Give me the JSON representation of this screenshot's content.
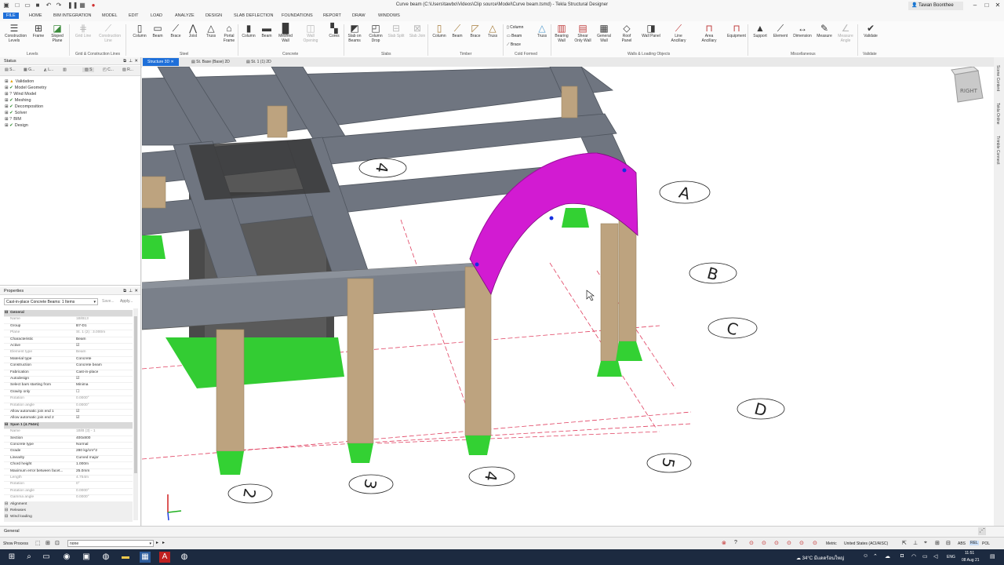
{
  "window": {
    "title": "Curve beam (C:\\Users\\tawbo\\Videos\\Clip source\\Model\\Curve beam.tsmd) - Tekla Structural Designer",
    "user": "Tawan Boonthee"
  },
  "menu_tabs": [
    "FILE",
    "HOME",
    "BIM INTEGRATION",
    "MODEL",
    "EDIT",
    "LOAD",
    "ANALYZE",
    "DESIGN",
    "SLAB DEFLECTION",
    "FOUNDATIONS",
    "REPORT",
    "DRAW",
    "WINDOWS"
  ],
  "ribbon": {
    "buttons": [
      {
        "label": "Construction Levels",
        "icon": "levels-icon"
      },
      {
        "label": "Frame",
        "icon": "frame-icon"
      },
      {
        "label": "Sloped Plane",
        "icon": "plane-icon"
      },
      {
        "label": "Grid Line",
        "icon": "grid-line-icon"
      },
      {
        "label": "Construction Line",
        "icon": "construction-line-icon"
      },
      {
        "label": "Column",
        "icon": "column-icon"
      },
      {
        "label": "Beam",
        "icon": "beam-icon"
      },
      {
        "label": "Brace",
        "icon": "brace-icon"
      },
      {
        "label": "Truss",
        "icon": "truss-icon"
      },
      {
        "label": "Portal Frame",
        "icon": "portal-icon"
      },
      {
        "label": "Column",
        "icon": "column-icon"
      },
      {
        "label": "Beam",
        "icon": "beam-icon"
      },
      {
        "label": "Meshed Wall",
        "icon": "wall-icon"
      },
      {
        "label": "Wall Opening",
        "icon": "opening-icon"
      },
      {
        "label": "Cores",
        "icon": "cores-icon"
      },
      {
        "label": "Slab on Beams",
        "icon": "slab-icon"
      },
      {
        "label": "Column Drop",
        "icon": "drop-icon"
      },
      {
        "label": "Slab Split",
        "icon": "split-icon"
      },
      {
        "label": "Slab Join",
        "icon": "join-icon"
      },
      {
        "label": "Column",
        "icon": "column-icon"
      },
      {
        "label": "Beam",
        "icon": "beam-icon"
      },
      {
        "label": "Brace",
        "icon": "brace-icon"
      },
      {
        "label": "Truss",
        "icon": "truss-icon"
      },
      {
        "label": "Truss",
        "icon": "truss-icon"
      },
      {
        "label": "Bearing Wall",
        "icon": "bearing-wall-icon"
      },
      {
        "label": "Shear Only Wall",
        "icon": "shear-wall-icon"
      },
      {
        "label": "General Wall",
        "icon": "general-wall-icon"
      },
      {
        "label": "Roof Panel",
        "icon": "roof-icon"
      },
      {
        "label": "Wall Panel",
        "icon": "wall-panel-icon"
      },
      {
        "label": "Line Ancillary",
        "icon": "line-ancillary-icon"
      },
      {
        "label": "Area Ancillary",
        "icon": "area-ancillary-icon"
      },
      {
        "label": "Equipment",
        "icon": "equipment-icon"
      },
      {
        "label": "Support",
        "icon": "support-icon"
      },
      {
        "label": "Element",
        "icon": "element-icon"
      },
      {
        "label": "Dimension",
        "icon": "dimension-icon"
      },
      {
        "label": "Measure",
        "icon": "measure-icon"
      },
      {
        "label": "Measure Angle",
        "icon": "angle-icon"
      },
      {
        "label": "Validate",
        "icon": "validate-icon"
      }
    ],
    "cold_formed": [
      "Column",
      "Beam",
      "Brace"
    ],
    "groups": [
      "Levels",
      "Grid & Construction Lines",
      "Steel",
      "Concrete",
      "Slabs",
      "Timber",
      "Cold Formed",
      "Walls & Loading Objects",
      "Miscellaneous",
      "Validate"
    ]
  },
  "status_panel": {
    "title": "Status",
    "tabs": [
      "S...",
      "G...",
      "L...",
      "S",
      "C...",
      "R..."
    ],
    "tree": [
      {
        "label": "Validation",
        "state": "warn"
      },
      {
        "label": "Model Geometry",
        "state": "ok"
      },
      {
        "label": "Wind Model",
        "state": "info"
      },
      {
        "label": "Meshing",
        "state": "ok"
      },
      {
        "label": "Decomposition",
        "state": "ok"
      },
      {
        "label": "Solver",
        "state": "ok"
      },
      {
        "label": "BIM",
        "state": "info"
      },
      {
        "label": "Design",
        "state": "ok"
      }
    ]
  },
  "properties_panel": {
    "title": "Properties",
    "selector": "Cast-in-place Concrete Beams: 1 Items",
    "save_label": "Save...",
    "apply_label": "Apply...",
    "rows": [
      {
        "key": "General",
        "value": "",
        "kind": "section"
      },
      {
        "key": "Name",
        "value": "1B/B13",
        "kind": "dim"
      },
      {
        "key": "Group",
        "value": "B7-D1",
        "kind": "normal"
      },
      {
        "key": "Plane",
        "value": "St. 1 (2) : 3.000m",
        "kind": "dim"
      },
      {
        "key": "Characteristic",
        "value": "Beam",
        "kind": "normal"
      },
      {
        "key": "Active",
        "value": "☑",
        "kind": "normal"
      },
      {
        "key": "Element type",
        "value": "Beam",
        "kind": "dim"
      },
      {
        "key": "Material type",
        "value": "Concrete",
        "kind": "normal"
      },
      {
        "key": "Construction",
        "value": "Concrete beam",
        "kind": "normal"
      },
      {
        "key": "Fabrication",
        "value": "Cast-in-place",
        "kind": "normal"
      },
      {
        "key": "Autodesign",
        "value": "☑",
        "kind": "normal"
      },
      {
        "key": "Select bars starting from",
        "value": "Minima",
        "kind": "normal"
      },
      {
        "key": "Gravity only",
        "value": "☐",
        "kind": "normal"
      },
      {
        "key": "Rotation",
        "value": "0.0000°",
        "kind": "dim"
      },
      {
        "key": "Rotation angle",
        "value": "0.0000°",
        "kind": "dim"
      },
      {
        "key": "Allow automatic join end 1",
        "value": "☑",
        "kind": "normal"
      },
      {
        "key": "Allow automatic join end 2",
        "value": "☑",
        "kind": "normal"
      },
      {
        "key": "Span 1 (4.754m)",
        "value": "",
        "kind": "section"
      },
      {
        "key": "Name",
        "value": "1B/B (3) - 1",
        "kind": "dim"
      },
      {
        "key": "Section",
        "value": "400x800",
        "kind": "normal"
      },
      {
        "key": "Concrete type",
        "value": "Normal",
        "kind": "normal"
      },
      {
        "key": "Grade",
        "value": "280 kg/cm^2",
        "kind": "normal"
      },
      {
        "key": "Linearity",
        "value": "Curved major",
        "kind": "normal"
      },
      {
        "key": "Chord height",
        "value": "1.000m",
        "kind": "normal"
      },
      {
        "key": "Maximum error between facet...",
        "value": "25.0mm",
        "kind": "normal"
      },
      {
        "key": "Length",
        "value": "4.754m",
        "kind": "dim"
      },
      {
        "key": "Rotation",
        "value": "0°",
        "kind": "dim"
      },
      {
        "key": "Rotation angle",
        "value": "0.0000°",
        "kind": "dim"
      },
      {
        "key": "Gamma angle",
        "value": "0.0000°",
        "kind": "dim"
      },
      {
        "key": "Alignment",
        "value": "",
        "kind": "sub"
      },
      {
        "key": "Releases",
        "value": "",
        "kind": "sub"
      },
      {
        "key": "Wind loading",
        "value": "",
        "kind": "sub"
      }
    ]
  },
  "view_tabs": [
    "Structure 3D",
    "St. Base (Base) 2D",
    "St. 1 (1) 2D"
  ],
  "viewport": {
    "viewcube_label": "RIGHT",
    "grid_labels": [
      "A",
      "B",
      "C",
      "D",
      "2",
      "3",
      "4",
      "5",
      "4"
    ]
  },
  "right_bar": [
    "Scene Content",
    "Tekla Online",
    "Trimble Connect"
  ],
  "bottom": {
    "general_label": "General",
    "show_process_label": "Show Process",
    "combo_value": "none",
    "units": "Metric",
    "code": "United States (ACI/AISC)",
    "toggles": [
      "ABS",
      "REL",
      "POL"
    ]
  },
  "taskbar": {
    "weather": "34°C มีแดดร้อนใหญ่",
    "lang": "ENG",
    "time": "11:51",
    "date": "08 Aug 21"
  },
  "colors": {
    "accent": "#1e6fd9",
    "curved_beam": "#d21bd2",
    "concrete_beam": "#6f7580",
    "column": "#bda37f",
    "support": "#2fd12f",
    "grid": "#e04060"
  }
}
